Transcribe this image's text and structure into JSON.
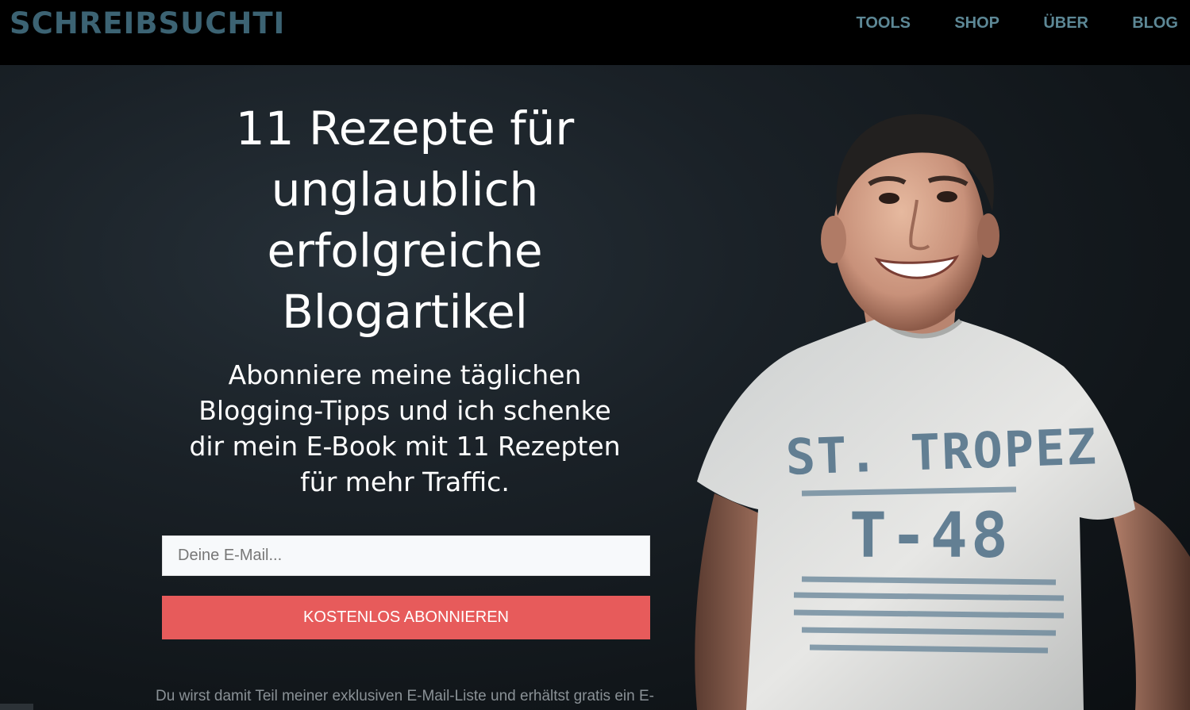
{
  "header": {
    "logo": "SCHREIBSUCHTI",
    "nav": [
      {
        "label": "TOOLS"
      },
      {
        "label": "SHOP"
      },
      {
        "label": "ÜBER"
      },
      {
        "label": "BLOG"
      }
    ]
  },
  "hero": {
    "headline_lines": [
      "11 Rezepte für",
      "unglaublich",
      "erfolgreiche",
      "Blogartikel"
    ],
    "subline_lines": [
      "Abonniere meine täglichen",
      "Blogging-Tipps und ich schenke",
      "dir mein E-Book mit 11 Rezepten",
      "für mehr Traffic."
    ],
    "email_placeholder": "Deine E-Mail...",
    "cta_label": "KOSTENLOS ABONNIEREN",
    "disclaimer_lines": [
      "Du wirst damit Teil meiner exklusiven E-Mail-Liste und erhältst gratis ein E-"
    ],
    "shirt_print_top": "ST. TROPEZ",
    "shirt_print_bottom": "T-48"
  },
  "colors": {
    "logo": "#3c6373",
    "nav": "#5d8896",
    "cta": "#e75b5b",
    "background": "#1a2127"
  }
}
